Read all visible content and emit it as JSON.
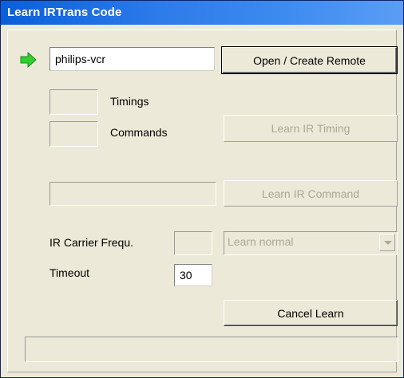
{
  "window": {
    "title": "Learn IRTrans Code"
  },
  "remote": {
    "arrow_icon": "green-arrow-icon",
    "name_value": "philips-vcr",
    "open_button_label": "Open / Create Remote"
  },
  "timing": {
    "timings_value": "",
    "timings_label": "Timings",
    "commands_value": "",
    "commands_label": "Commands",
    "learn_timing_label": "Learn IR Timing"
  },
  "command": {
    "name_value": "",
    "learn_command_label": "Learn IR Command"
  },
  "carrier": {
    "label": "IR Carrier Frequ.",
    "value": "",
    "mode_selected": "Learn normal"
  },
  "timeout": {
    "label": "Timeout",
    "value": "30"
  },
  "actions": {
    "cancel_label": "Cancel Learn"
  },
  "status": {
    "text": ""
  },
  "colors": {
    "title_gradient_start": "#0a5fd8",
    "arrow_green": "#2fd12f",
    "dialog_bg": "#ece9d8",
    "disabled_text": "#aca899"
  }
}
